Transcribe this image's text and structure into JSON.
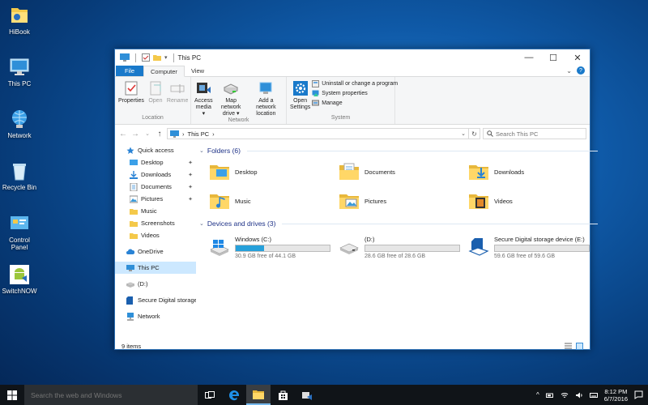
{
  "desktop": {
    "icons": [
      {
        "label": "HiBook"
      },
      {
        "label": "This PC"
      },
      {
        "label": "Network"
      },
      {
        "label": "Recycle Bin"
      },
      {
        "label": "Control Panel"
      },
      {
        "label": "SwitchNOW"
      }
    ]
  },
  "window": {
    "title": "This PC",
    "controls": {
      "minimize": "—",
      "maximize": "☐",
      "close": "✕"
    },
    "tabs": {
      "file": "File",
      "computer": "Computer",
      "view": "View"
    },
    "help_icons": {
      "chevron": "⌄",
      "help": "?"
    }
  },
  "ribbon": {
    "location": {
      "label": "Location",
      "properties": "Properties",
      "open": "Open",
      "rename": "Rename"
    },
    "network": {
      "label": "Network",
      "access_media_1": "Access",
      "access_media_2": "media ▾",
      "map_drive_1": "Map network",
      "map_drive_2": "drive ▾",
      "add_location_1": "Add a network",
      "add_location_2": "location"
    },
    "system": {
      "label": "System",
      "open_settings_1": "Open",
      "open_settings_2": "Settings",
      "uninstall": "Uninstall or change a program",
      "system_properties": "System properties",
      "manage": "Manage"
    }
  },
  "address": {
    "back": "←",
    "forward": "→",
    "recent": "⌄",
    "up": "↑",
    "path_sep": "›",
    "path": "This PC",
    "path_tail": "›",
    "dropdown": "⌄",
    "refresh": "↻",
    "search_placeholder": "Search This PC"
  },
  "navpane": {
    "items": [
      {
        "label": "Quick access"
      },
      {
        "label": "Desktop",
        "pin": "📌"
      },
      {
        "label": "Downloads",
        "pin": "📌"
      },
      {
        "label": "Documents",
        "pin": "📌"
      },
      {
        "label": "Pictures",
        "pin": "📌"
      },
      {
        "label": "Music"
      },
      {
        "label": "Screenshots"
      },
      {
        "label": "Videos"
      },
      {
        "label": "OneDrive"
      },
      {
        "label": "This PC"
      },
      {
        "label": "(D:)"
      },
      {
        "label": "Secure Digital storage"
      },
      {
        "label": "Network"
      }
    ]
  },
  "content": {
    "folders_header": "Folders (6)",
    "folders": [
      {
        "label": "Desktop"
      },
      {
        "label": "Documents"
      },
      {
        "label": "Downloads"
      },
      {
        "label": "Music"
      },
      {
        "label": "Pictures"
      },
      {
        "label": "Videos"
      }
    ],
    "drives_header": "Devices and drives (3)",
    "drives": [
      {
        "label": "Windows (C:)",
        "free": "30.9 GB free of 44.1 GB",
        "used_fraction": 0.3
      },
      {
        "label": "(D:)",
        "free": "28.6 GB free of 28.6 GB",
        "used_fraction": 0.0
      },
      {
        "label": "Secure Digital storage device (E:)",
        "free": "59.6 GB free of 59.6 GB",
        "used_fraction": 0.0
      }
    ]
  },
  "status": {
    "items": "9 items"
  },
  "taskbar": {
    "search_placeholder": "Search the web and Windows",
    "time": "8:12 PM",
    "date": "6/7/2016"
  },
  "colors": {
    "accent": "#1979ca",
    "drive_fill": "#26a0da",
    "selected": "#cce8ff",
    "header_text": "#1e3287"
  }
}
